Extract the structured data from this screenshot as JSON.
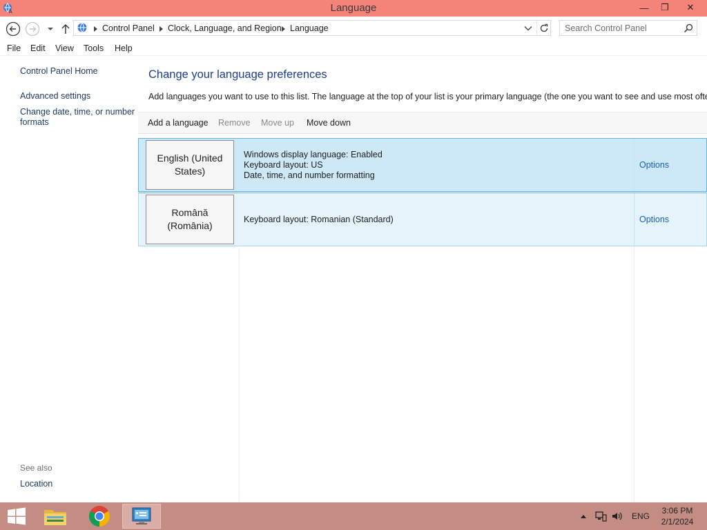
{
  "window": {
    "title": "Language",
    "minimize_glyph": "—",
    "maximize_glyph": "❐",
    "close_glyph": "✕"
  },
  "address": {
    "breadcrumbs": [
      "Control Panel",
      "Clock, Language, and Region",
      "Language"
    ],
    "search_placeholder": "Search Control Panel"
  },
  "menu": [
    "File",
    "Edit",
    "View",
    "Tools",
    "Help"
  ],
  "sidebar": {
    "home": "Control Panel Home",
    "advanced": "Advanced settings",
    "change_formats": "Change date, time, or number formats",
    "see_also": "See also",
    "location": "Location"
  },
  "main": {
    "heading": "Change your language preferences",
    "description": "Add languages you want to use to this list. The language at the top of your list is your primary language (the one you want to see and use most often).",
    "toolbar": {
      "add": "Add a language",
      "remove": "Remove",
      "move_up": "Move up",
      "move_down": "Move down"
    },
    "languages": [
      {
        "name": "English (United States)",
        "details": [
          "Windows display language: Enabled",
          "Keyboard layout: US",
          "Date, time, and number formatting"
        ],
        "options": "Options",
        "selected": true
      },
      {
        "name": "Română (România)",
        "details": [
          "Keyboard layout: Romanian (Standard)"
        ],
        "options": "Options",
        "selected": false
      }
    ]
  },
  "taskbar": {
    "apps": [
      "file-explorer-icon",
      "chrome-icon",
      "control-panel-icon"
    ],
    "input_language": "ENG",
    "time": "3:06 PM",
    "date": "2/1/2024"
  },
  "colors": {
    "titlebar": "#f4837a",
    "taskbar": "#c48d84",
    "selected_row": "#cde8f6",
    "link": "#1a5fb4",
    "heading": "#1e3f8c"
  }
}
